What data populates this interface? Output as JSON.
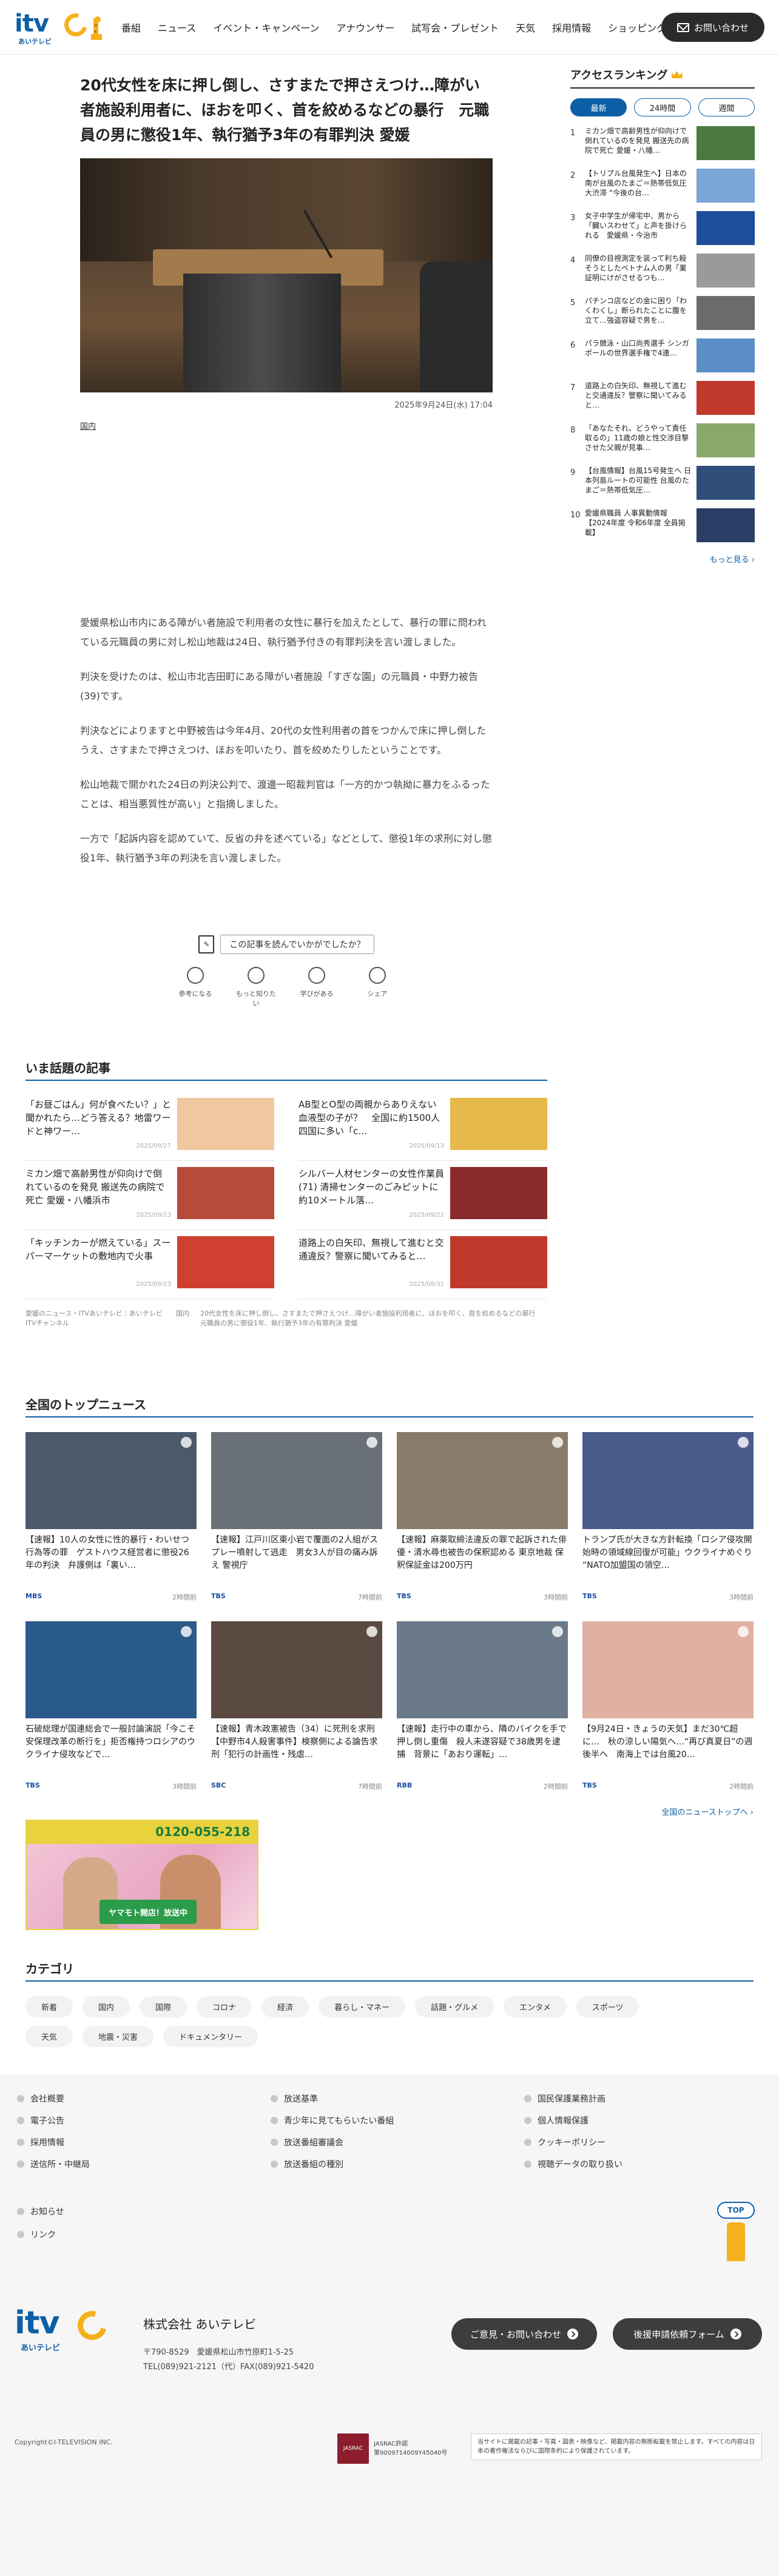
{
  "header": {
    "logo_text": "itv",
    "logo_sub": "あいテレビ",
    "nav": [
      "番組",
      "ニュース",
      "イベント・キャンペーン",
      "アナウンサー",
      "試写会・プレゼント",
      "天気",
      "採用情報",
      "ショッピング"
    ],
    "contact_label": "お問い合わせ"
  },
  "article": {
    "title": "20代女性を床に押し倒し、さすまたで押さえつけ…障がい者施設利用者に、ほおを叩く、首を絞めるなどの暴行　元職員の男に懲役1年、執行猶予3年の有罪判決 愛媛",
    "date": "2025年9月24日(水) 17:04",
    "tag": "国内",
    "paragraphs": [
      "愛媛県松山市内にある障がい者施設で利用者の女性に暴行を加えたとして、暴行の罪に問われている元職員の男に対し松山地裁は24日、執行猶予付きの有罪判決を言い渡しました。",
      "判決を受けたのは、松山市北吉田町にある障がい者施設「すぎな園」の元職員・中野力被告(39)です。",
      "判決などによりますと中野被告は今年4月、20代の女性利用者の首をつかんで床に押し倒したうえ、さすまたで押さえつけ、ほおを叩いたり、首を絞めたりしたということです。",
      "松山地裁で開かれた24日の判決公判で、渡邊一昭裁判官は「一方的かつ執拗に暴力をふるったことは、相当悪質性が高い」と指摘しました。",
      "一方で「起訴内容を認めていて、反省の弁を述べている」などとして、懲役1年の求刑に対し懲役1年、執行猶予3年の判決を言い渡しました。"
    ]
  },
  "feedback": {
    "question": "この記事を読んでいかがでしたか？",
    "options": [
      "参考になる",
      "もっと知りたい",
      "学びがある",
      "シェア"
    ]
  },
  "ranking": {
    "title": "アクセスランキング",
    "tabs": [
      "最新",
      "24時間",
      "週間"
    ],
    "items": [
      {
        "num": "1",
        "text": "ミカン畑で高齢男性が仰向けで倒れているのを発見 搬送先の病院で死亡 愛媛・八幡…",
        "color": "#4a7a3e"
      },
      {
        "num": "2",
        "text": "【トリプル台風発生へ】日本の南が台風のたまご＝熱帯低気圧大渋滞 “今後の台…",
        "color": "#7aa6d8"
      },
      {
        "num": "3",
        "text": "女子中学生が帰宅中、男から「臓いスわせて」と声を掛けられる　愛媛県・今治市",
        "color": "#1d4e9a"
      },
      {
        "num": "4",
        "text": "同僚の目視測定を装って利ち殺そうとしたベトナム人の男「業証明にけがさせるつも…",
        "color": "#9a9a9a"
      },
      {
        "num": "5",
        "text": "パチンコ店などの金に困り「わくわくし」断られたことに腹を立て…強盗容疑で男を…",
        "color": "#6b6b6b"
      },
      {
        "num": "6",
        "text": "パラ競泳・山口尚秀選手 シンガポールの世界選手権で4連…",
        "color": "#5b8ec4"
      },
      {
        "num": "7",
        "text": "道路上の白矢印、無視して進むと交通違反？警察に聞いてみると…",
        "color": "#c0392b"
      },
      {
        "num": "8",
        "text": "「あなたそれ、どうやって責任取るの」11歳の娘と性交渉目撃させた父親が見事…",
        "color": "#8aa86a"
      },
      {
        "num": "9",
        "text": "【台風情報】台風15号発生へ 日本列島ルートの可能性 台風のたまご＝熱帯低気圧…",
        "color": "#2f4f7a"
      },
      {
        "num": "10",
        "text": "愛媛県職員 人事異動情報 【2024年度 令和6年度 全員掲載】",
        "color": "#2d3e66"
      }
    ],
    "more": "もっと見る ›"
  },
  "trending": {
    "title": "いま話題の記事",
    "items": [
      {
        "text": "「お昼ごはん」何が食べたい？」と聞かれたら…どう答える？地雷ワードと神ワー…",
        "date": "2025/09/27",
        "color": "#f0c8a0"
      },
      {
        "text": "AB型とO型の両親からありえない血液型の子が？　全国に約1500人　四国に多い「c…",
        "date": "2025/09/13",
        "color": "#e7b84a"
      },
      {
        "text": "ミカン畑で高齢男性が仰向けで倒れているのを発見 搬送先の病院で死亡 愛媛・八幡浜市",
        "date": "2025/09/23",
        "color": "#b84a3a"
      },
      {
        "text": "シルバー人材センターの女性作業員 (71) 清掃センターのごみピットに約10メートル落…",
        "date": "2025/09/22",
        "color": "#8a2a2a"
      },
      {
        "text": "「キッチンカーが燃えている」スーパーマーケットの敷地内で火事",
        "date": "2025/09/23",
        "color": "#d04030"
      },
      {
        "text": "道路上の白矢印、無視して進むと交通違反？警察に聞いてみると…",
        "date": "2025/08/31",
        "color": "#c0392b"
      }
    ],
    "breadcrumb": [
      "愛媛のニュース・ITVあいテレビ｜あいテレビITVチャンネル",
      "国内",
      "20代女性を床に押し倒し、さすまたで押さえつけ…障がい者施設利用者に、ほおを叩く、首を絞めるなどの暴行　元職員の男に懲役1年、執行猶予3年の有罪判決 愛媛"
    ]
  },
  "topnews": {
    "title": "全国のトップニュース",
    "items": [
      {
        "text": "【速報】10人の女性に性的暴行・わいせつ行為等の罪　ゲストハウス経営者に懲役26年の判決　弁護側は「裏い…",
        "src": "MBS",
        "time": "2時間前",
        "color": "#4a5a6a"
      },
      {
        "text": "【速報】江戸川区東小岩で覆面の2人組がスプレー噴射して逃走　男女3人が目の痛み訴え 警視庁",
        "src": "TBS",
        "time": "7時間前",
        "color": "#6a7078"
      },
      {
        "text": "【速報】麻薬取締法違反の罪で起訴された俳優・清水尋也被告の保釈認める 東京地裁 保釈保証金は200万円",
        "src": "TBS",
        "time": "3時間前",
        "color": "#8a7a6a"
      },
      {
        "text": "トランプ氏が大きな方針転換「ロシア侵攻開始時の領域線回復が可能」ウクライナめぐり “NATO加盟国の領空…",
        "src": "TBS",
        "time": "3時間前",
        "color": "#4a5a8a"
      },
      {
        "text": "石破総理が国連総会で一般討論演説「今こそ安保理改革の断行を」拒否権持つロシアのウクライナ侵攻などで…",
        "src": "TBS",
        "time": "3時間前",
        "color": "#2a5a8a"
      },
      {
        "text": "【速報】青木政憲被告（34）に死刑を求刑【中野市4人殺害事件】検察側による論告求刑「犯行の計画性・残虐…",
        "src": "SBC",
        "time": "7時間前",
        "color": "#5a4a42"
      },
      {
        "text": "【速報】走行中の車から、隣のバイクを手で押し倒し重傷　殺人未遂容疑で38歳男を逮捕　背景に「あおり運転」…",
        "src": "RBB",
        "time": "2時間前",
        "color": "#6a7a8a"
      },
      {
        "text": "【9月24日・きょうの天気】まだ30℃超に…　秋の涼しい陽気へ…“再び真夏日”の週後半へ　南海上では台風20…",
        "src": "TBS",
        "time": "2時間前",
        "color": "#e0b0a0"
      }
    ],
    "all_link": "全国のニューストップへ ›"
  },
  "banner": {
    "phone": "0120-055-218",
    "sign": "ヤマモト開店！放送中"
  },
  "category": {
    "title": "カテゴリ",
    "items": [
      "新着",
      "国内",
      "国際",
      "コロナ",
      "経済",
      "暮らし・マネー",
      "話題・グルメ",
      "エンタメ",
      "スポーツ",
      "天気",
      "地震・災害",
      "ドキュメンタリー"
    ]
  },
  "footer": {
    "links": [
      "会社概要",
      "放送基準",
      "国民保護業務計画",
      "電子公告",
      "青少年に見てもらいたい番組",
      "個人情報保護",
      "採用情報",
      "放送番組審議会",
      "クッキーポリシー",
      "送信所・中継局",
      "放送番組の種別",
      "視聴データの取り扱い"
    ],
    "extra": [
      "お知らせ",
      "リンク"
    ],
    "top": "TOP",
    "company": "株式会社 あいテレビ",
    "address": "〒790-8529　愛媛県松山市竹原町1-5-25",
    "tel": "TEL(089)921-2121（代）FAX(089)921-5420",
    "btn1": "ご意見・お問い合わせ",
    "btn2": "後援申請依頼フォーム",
    "copyright": "Copyright©I-TELEVISION INC.",
    "jasrac": "JASRAC許諾\n第9009714009Y45040号",
    "notice": "当サイトに掲載の記事・写真・図表・映像など、掲載内容の無断転載を禁止します。すべての内容は日本の著作権法ならびに国際条約により保護されています。"
  }
}
